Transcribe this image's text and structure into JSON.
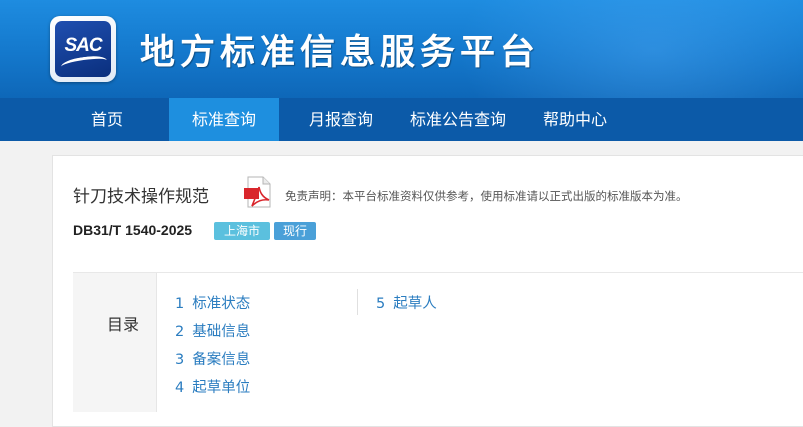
{
  "header": {
    "logo_text": "SAC",
    "site_title": "地方标准信息服务平台"
  },
  "nav": {
    "items": [
      {
        "label": "首页",
        "active": false
      },
      {
        "label": "标准查询",
        "active": true
      },
      {
        "label": "月报查询",
        "active": false
      },
      {
        "label": "标准公告查询",
        "active": false
      },
      {
        "label": "帮助中心",
        "active": false
      }
    ]
  },
  "standard": {
    "title": "针刀技术操作规范",
    "disclaimer": "免责声明：本平台标准资料仅供参考，使用标准请以正式出版的标准版本为准。",
    "code": "DB31/T 1540-2025",
    "region": "上海市",
    "status": "现行"
  },
  "toc": {
    "label": "目录",
    "items": [
      {
        "num": "1",
        "label": "标准状态"
      },
      {
        "num": "2",
        "label": "基础信息"
      },
      {
        "num": "3",
        "label": "备案信息"
      },
      {
        "num": "4",
        "label": "起草单位"
      },
      {
        "num": "5",
        "label": "起草人"
      }
    ]
  },
  "colors": {
    "banner": "#1478cc",
    "nav": "#0c5aa8",
    "nav_active": "#1e8fdf",
    "link": "#2b7dc0",
    "badge_region": "#5bc0de",
    "badge_status": "#4aa0d8"
  },
  "icons": {
    "document": "pdf-icon"
  }
}
